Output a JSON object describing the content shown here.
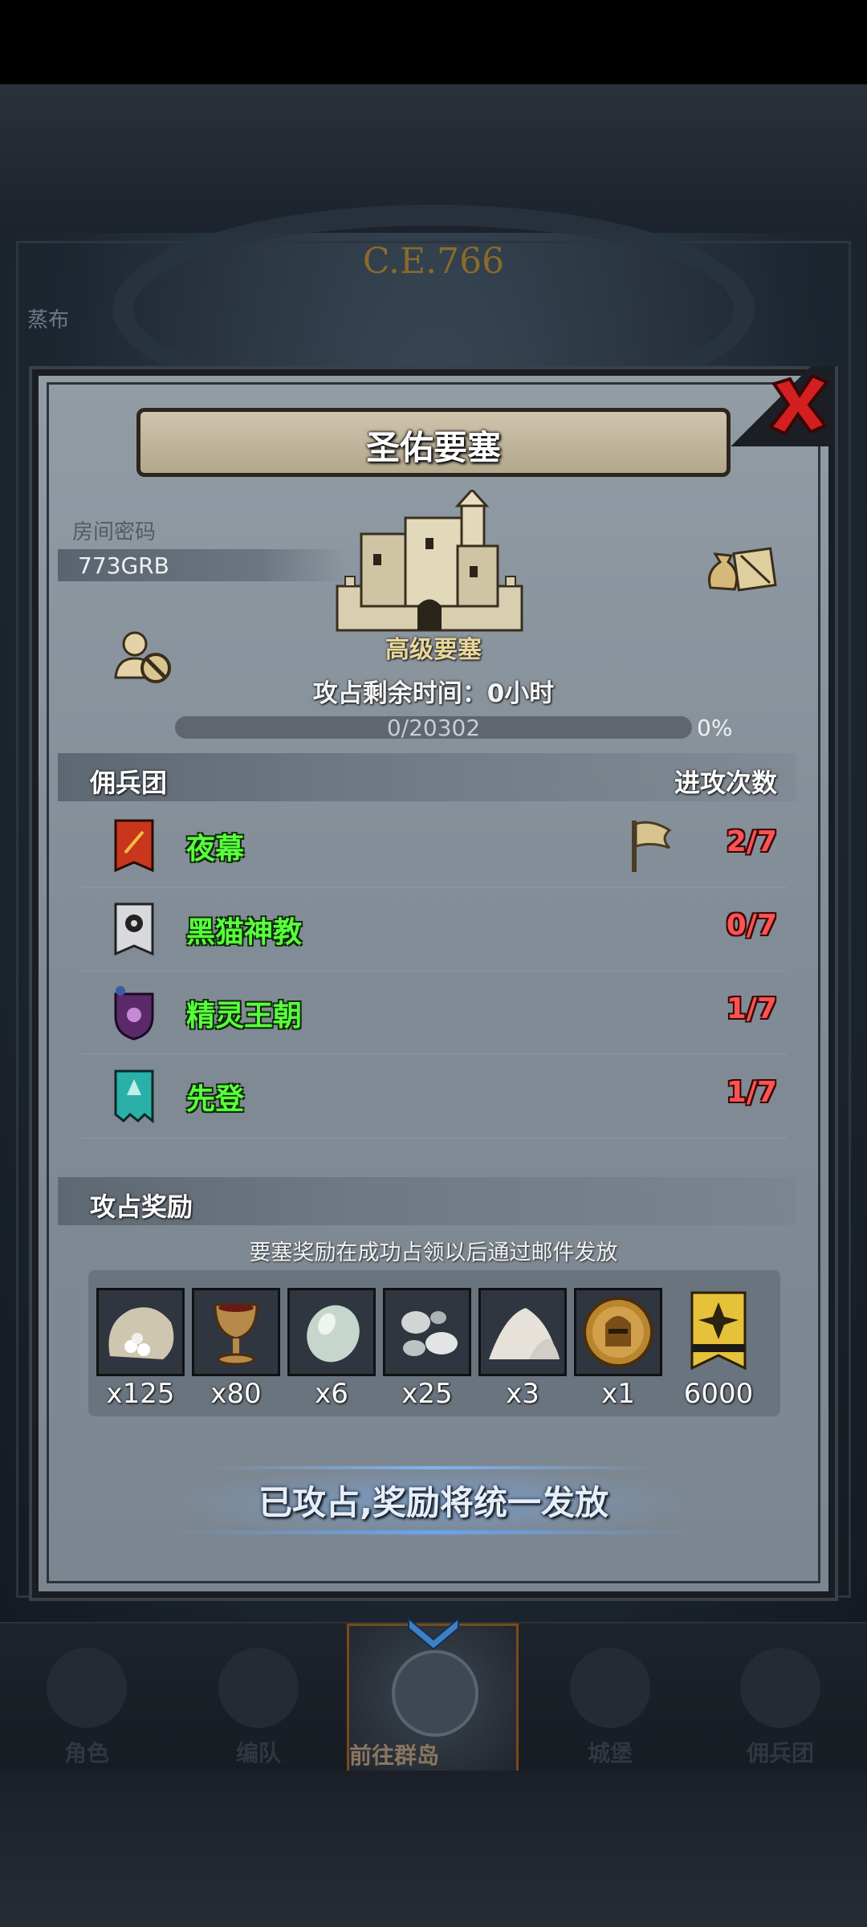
{
  "background": {
    "era_label": "C.E.766",
    "side_label": "蒸布"
  },
  "dialog": {
    "title": "圣佑要塞",
    "room_code_label": "房间密码",
    "room_code": "773GRB",
    "fortress_level": "高级要塞",
    "occupation_time_text": "攻占剩余时间：0小时",
    "progress": {
      "text": "0/20302",
      "percent_label": "0%",
      "fraction": 0.0
    },
    "mercenary_header": "佣兵团",
    "attack_count_header": "进攻次数",
    "mercenaries": [
      {
        "name": "夜幕",
        "count": "2/7",
        "emblem": "red-banner-icon",
        "color": "#c8361c"
      },
      {
        "name": "黑猫神教",
        "count": "0/7",
        "emblem": "black-cat-banner-icon",
        "color": "#d7d9dc"
      },
      {
        "name": "精灵王朝",
        "count": "1/7",
        "emblem": "elf-shield-icon",
        "color": "#5a2a6a"
      },
      {
        "name": "先登",
        "count": "1/7",
        "emblem": "teal-banner-icon",
        "color": "#2ab0a8"
      }
    ],
    "reward_header": "攻占奖励",
    "reward_note": "要塞奖励在成功占领以后通过邮件发放",
    "rewards": [
      {
        "icon": "sugar-sack-icon",
        "qty": "x125"
      },
      {
        "icon": "goblet-icon",
        "qty": "x80"
      },
      {
        "icon": "moonstone-icon",
        "qty": "x6"
      },
      {
        "icon": "silver-orbs-icon",
        "qty": "x25"
      },
      {
        "icon": "salt-pile-icon",
        "qty": "x3"
      },
      {
        "icon": "knight-medal-icon",
        "qty": "x1"
      },
      {
        "icon": "gold-banner-icon",
        "qty": "6000"
      }
    ],
    "bottom_button": "已攻占,奖励将统一发放"
  },
  "nav": {
    "items": [
      {
        "label": "角色",
        "icon": "character-icon"
      },
      {
        "label": "编队",
        "icon": "formation-icon"
      },
      {
        "label": "前往群岛",
        "icon": "globe-icon",
        "active": true
      },
      {
        "label": "城堡",
        "icon": "castle-icon"
      },
      {
        "label": "佣兵团",
        "icon": "mercenary-icon"
      }
    ]
  },
  "colors": {
    "mercenary_name": "#57ff3c",
    "attack_count": "#ff5252",
    "fortress_name": "#e9d69a",
    "nav_active_border": "#7a4a18"
  }
}
